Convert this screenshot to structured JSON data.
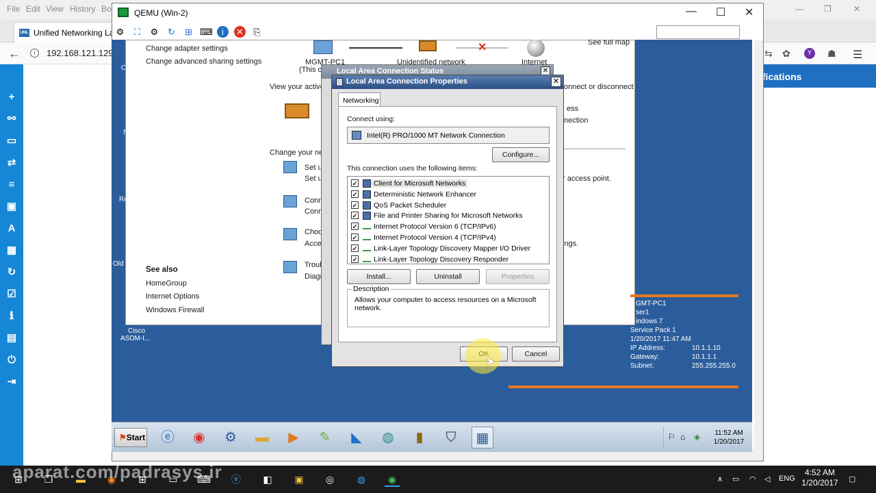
{
  "host": {
    "menu": [
      "File",
      "Edit",
      "View",
      "History",
      "Bo"
    ],
    "tab_title": "Unified Networking Lab",
    "favicon_text": "UNL",
    "url": "192.168.121.129",
    "notifications_label": "ifications",
    "watermark": "aparat.com/padrasys.ir",
    "tray_lang": "ENG",
    "clock_time": "4:52 AM",
    "clock_date": "1/20/2017"
  },
  "qemu": {
    "title": "QEMU (Win-2)"
  },
  "explorer": {
    "left_links": [
      "Change adapter settings",
      "Change advanced sharing settings"
    ],
    "see_also_title": "See also",
    "see_also": [
      "HomeGroup",
      "Internet Options",
      "Windows Firewall"
    ],
    "see_full_map": "See full map",
    "map_node_pc": "MGMT-PC1",
    "map_node_pc_sub": "(This co",
    "map_node_network": "Unidentified network",
    "map_node_internet": "Internet",
    "view_active": "View your active",
    "connect_disconnect": "onnect or disconnect",
    "access_frag": "ess",
    "connection_frag": "nection",
    "change_net": "Change your net",
    "setup_1": "Set u",
    "setup_2": "Set u",
    "access_point": "r access point.",
    "conn_1": "Conn",
    "conn_2": "Conn",
    "choose": "Choo",
    "access": "Acces",
    "settings_frag": "ings.",
    "troubleshoot": "Troub",
    "diagnose": "Diagn"
  },
  "desktop": {
    "label_c": "C",
    "label_n": "N",
    "label_re": "Re",
    "label_old": "Old",
    "asdm_1": "Cisco",
    "asdm_2": "ASDM-I..."
  },
  "bginfo": {
    "host": "GMT-PC1",
    "user": "ser1",
    "os": "indows 7",
    "sp": "Service Pack 1",
    "boot": "1/20/2017 11:47 AM",
    "ip_label": "IP Address:",
    "ip": "10.1.1.10",
    "gw_label": "Gateway:",
    "gw": "10.1.1.1",
    "subnet_label": "Subnet:",
    "subnet": "255.255.255.0"
  },
  "guest_taskbar": {
    "start": "Start",
    "clock_time": "11:52 AM",
    "clock_date": "1/20/2017"
  },
  "status_dialog": {
    "title": "Local Area Connection Status"
  },
  "properties_dialog": {
    "title": "Local Area Connection Properties",
    "tab": "Networking",
    "connect_using_label": "Connect using:",
    "adapter": "Intel(R) PRO/1000 MT Network Connection",
    "configure": "Configure...",
    "items_label": "This connection uses the following items:",
    "items": [
      {
        "label": "Client for Microsoft Networks",
        "checked": true,
        "icon": "pc"
      },
      {
        "label": "Deterministic Network Enhancer",
        "checked": true,
        "icon": "pc"
      },
      {
        "label": "QoS Packet Scheduler",
        "checked": true,
        "icon": "pc"
      },
      {
        "label": "File and Printer Sharing for Microsoft Networks",
        "checked": true,
        "icon": "pc"
      },
      {
        "label": "Internet Protocol Version 6 (TCP/IPv6)",
        "checked": true,
        "icon": "net"
      },
      {
        "label": "Internet Protocol Version 4 (TCP/IPv4)",
        "checked": true,
        "icon": "net"
      },
      {
        "label": "Link-Layer Topology Discovery Mapper I/O Driver",
        "checked": true,
        "icon": "net"
      },
      {
        "label": "Link-Layer Topology Discovery Responder",
        "checked": true,
        "icon": "net"
      }
    ],
    "install": "Install...",
    "uninstall": "Uninstall",
    "properties": "Properties",
    "description_legend": "Description",
    "description": "Allows your computer to access resources on a Microsoft network.",
    "ok": "OK",
    "cancel": "Cancel"
  },
  "colors": {
    "guest_desktop": "#2b5d9c",
    "host_sidebar": "#1686d6",
    "accent_orange": "#e87a1f"
  }
}
